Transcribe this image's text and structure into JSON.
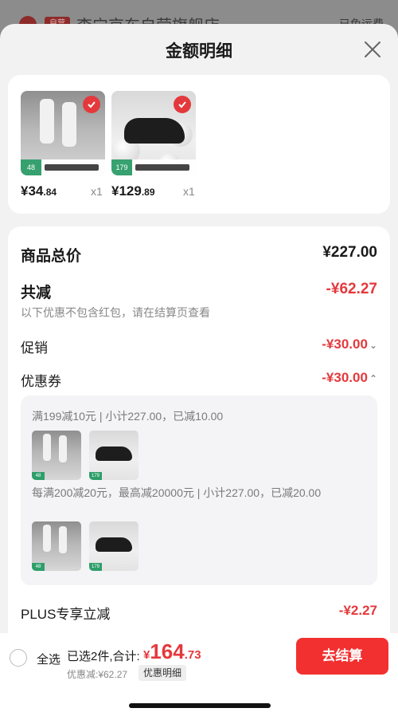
{
  "background": {
    "badge": "自营",
    "store_name": "李宁京东自营旗舰店",
    "shipping": "已免运费"
  },
  "sheet": {
    "title": "金额明细"
  },
  "products": [
    {
      "price_int": "¥34",
      "price_dec": ".84",
      "qty": "x1",
      "tag_num": "48"
    },
    {
      "price_int": "¥129",
      "price_dec": ".89",
      "qty": "x1",
      "tag_num": "179"
    }
  ],
  "summary": {
    "total_label": "商品总价",
    "total_value": "¥227.00",
    "reduce_label": "共减",
    "reduce_value": "-¥62.27",
    "reduce_note": "以下优惠不包含红包，请在结算页查看",
    "promo_label": "促销",
    "promo_value": "-¥30.00",
    "coupon_label": "优惠券",
    "coupon_value": "-¥30.00",
    "coupon_1": "满199减10元 | 小计227.00，已减10.00",
    "coupon_2": "每满200减20元，最高减20000元 | 小计227.00，已减20.00",
    "plus_label": "PLUS专享立减",
    "plus_value": "-¥2.27"
  },
  "bottom": {
    "select_all": "全选",
    "selected": "已选2件,合计:",
    "total_sym": "¥",
    "total_int": "164",
    "total_dec": ".73",
    "discount": "优惠减:¥62.27",
    "detail_button": "优惠明细",
    "checkout_button": "去结算"
  },
  "colors": {
    "accent_red": "#e4393c",
    "checkout_red": "#f23030",
    "tag_green": "#2e9e6a"
  }
}
